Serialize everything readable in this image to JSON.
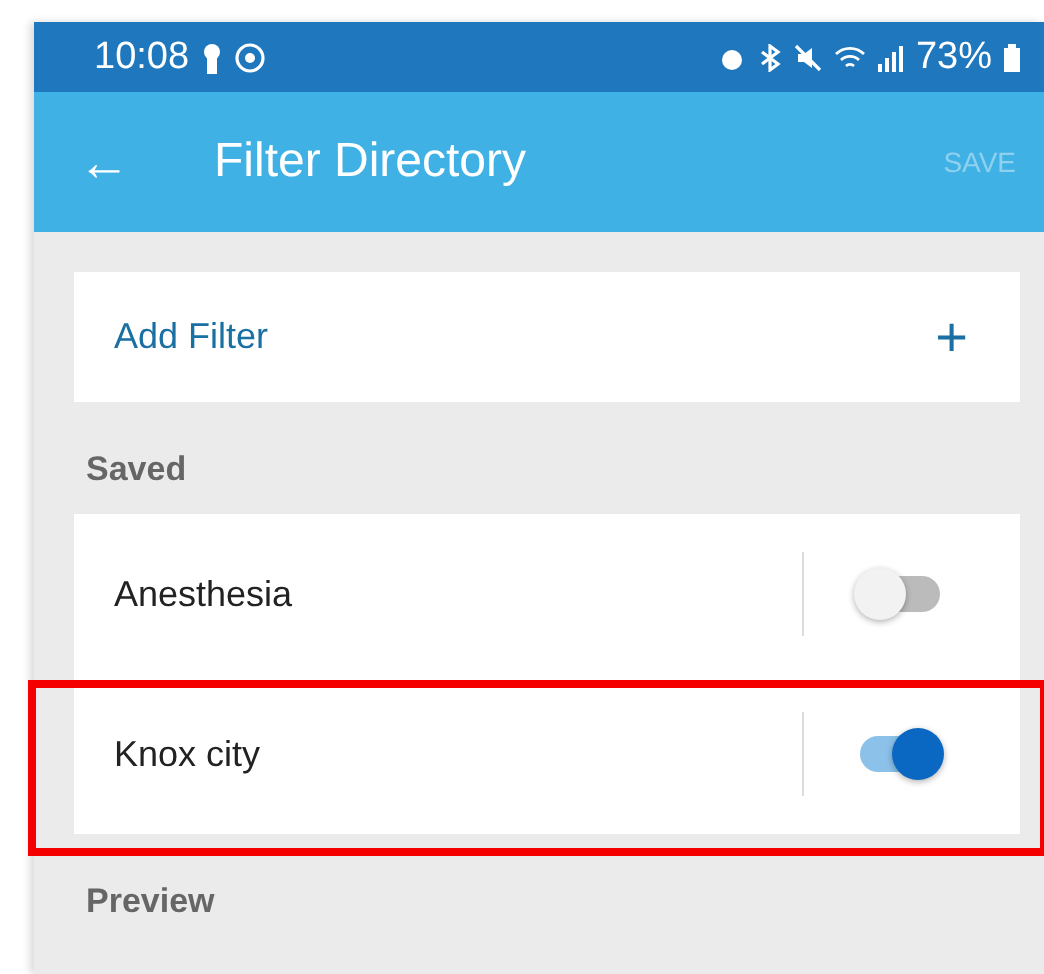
{
  "status_bar": {
    "time": "10:08",
    "battery": "73%"
  },
  "app_bar": {
    "back": "←",
    "title": "Filter Directory",
    "action": {
      "label": "SAVE",
      "disabled": true
    }
  },
  "add_filter": {
    "label": "Add Filter",
    "icon": "+"
  },
  "saved": {
    "heading": "Saved",
    "items": [
      {
        "name": "Anesthesia",
        "on": false,
        "highlighted": false
      },
      {
        "name": "Knox city",
        "on": true,
        "highlighted": true
      }
    ]
  },
  "preview": {
    "heading": "Preview"
  }
}
